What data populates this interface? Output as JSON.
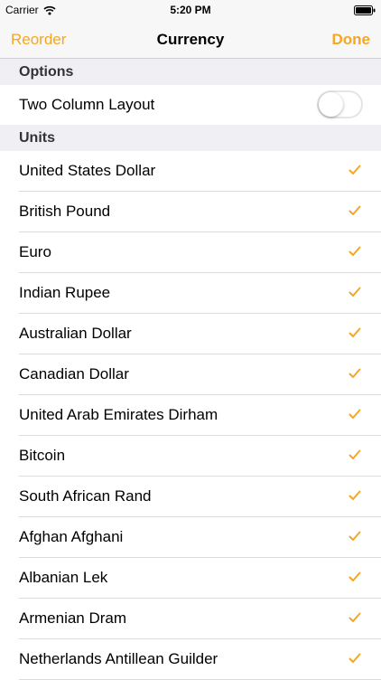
{
  "status_bar": {
    "carrier": "Carrier",
    "time": "5:20 PM",
    "icons": [
      "wifi-icon",
      "battery-icon"
    ]
  },
  "nav": {
    "left_label": "Reorder",
    "title": "Currency",
    "right_label": "Done",
    "accent_color": "#f5a623"
  },
  "options": {
    "header": "Options",
    "two_column_label": "Two Column Layout",
    "two_column_on": false
  },
  "units": {
    "header": "Units",
    "items": [
      {
        "label": "United States Dollar",
        "checked": true
      },
      {
        "label": "British Pound",
        "checked": true
      },
      {
        "label": "Euro",
        "checked": true
      },
      {
        "label": "Indian Rupee",
        "checked": true
      },
      {
        "label": "Australian Dollar",
        "checked": true
      },
      {
        "label": "Canadian Dollar",
        "checked": true
      },
      {
        "label": "United Arab Emirates Dirham",
        "checked": true
      },
      {
        "label": "Bitcoin",
        "checked": true
      },
      {
        "label": "South African Rand",
        "checked": true
      },
      {
        "label": "Afghan Afghani",
        "checked": true
      },
      {
        "label": "Albanian Lek",
        "checked": true
      },
      {
        "label": "Armenian Dram",
        "checked": true
      },
      {
        "label": "Netherlands Antillean Guilder",
        "checked": true
      }
    ]
  }
}
